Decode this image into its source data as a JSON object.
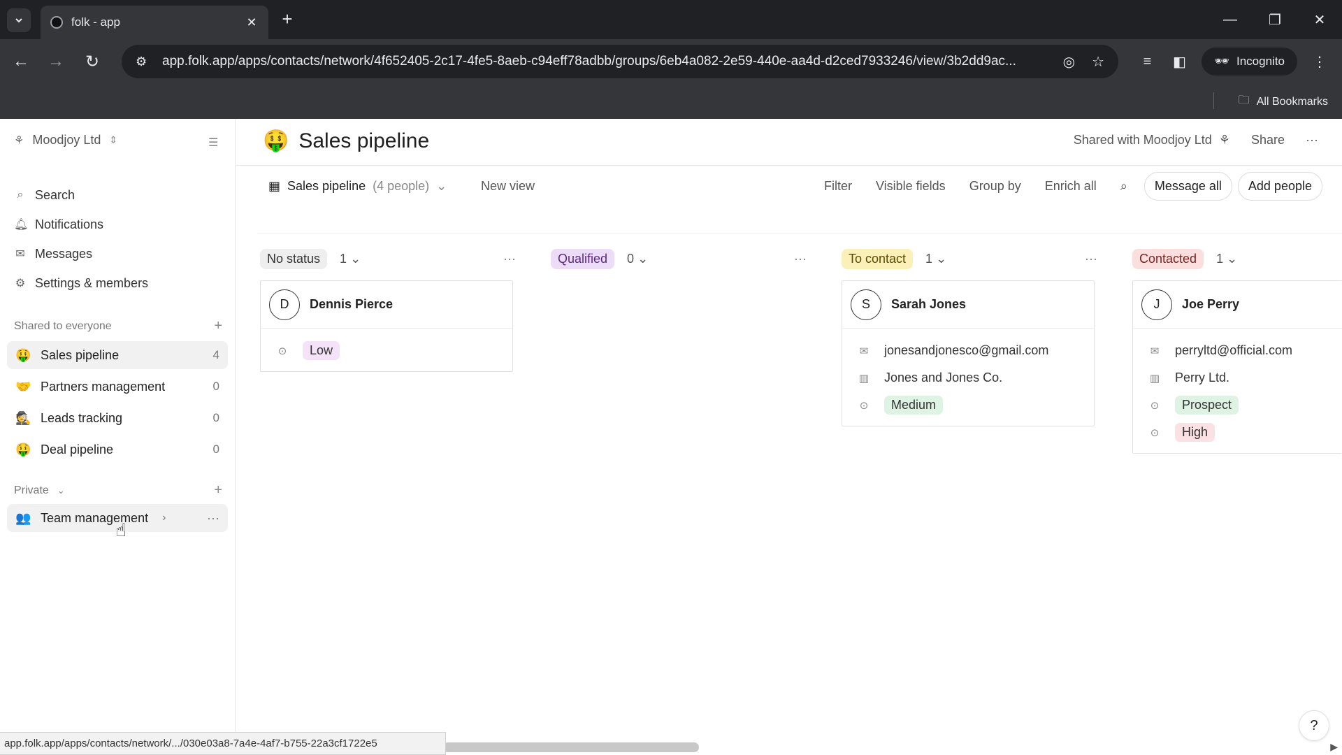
{
  "browser": {
    "tab_title": "folk - app",
    "url": "app.folk.app/apps/contacts/network/4f652405-2c17-4fe5-8aeb-c94eff78adbb/groups/6eb4a082-2e59-440e-aa4d-d2ced7933246/view/3b2dd9ac...",
    "incognito_label": "Incognito",
    "bookmarks_label": "All Bookmarks",
    "status_url": "app.folk.app/apps/contacts/network/.../030e03a8-7a4e-4af7-b755-22a3cf1722e5"
  },
  "sidebar": {
    "workspace": "Moodjoy Ltd",
    "nav": [
      {
        "label": "Search",
        "icon": "search-icon"
      },
      {
        "label": "Notifications",
        "icon": "bell-icon"
      },
      {
        "label": "Messages",
        "icon": "mail-icon"
      },
      {
        "label": "Settings & members",
        "icon": "gear-icon"
      }
    ],
    "shared_header": "Shared to everyone",
    "shared_groups": [
      {
        "emoji": "🤑",
        "label": "Sales pipeline",
        "count": "4"
      },
      {
        "emoji": "🤝",
        "label": "Partners management",
        "count": "0"
      },
      {
        "emoji": "🕵",
        "label": "Leads tracking",
        "count": "0"
      },
      {
        "emoji": "🤑",
        "label": "Deal pipeline",
        "count": "0"
      }
    ],
    "private_header": "Private",
    "private_groups": [
      {
        "emoji": "👥",
        "label": "Team management"
      }
    ]
  },
  "header": {
    "emoji": "🤑",
    "title": "Sales pipeline",
    "shared_with": "Shared with Moodjoy Ltd",
    "share": "Share"
  },
  "viewbar": {
    "view_name": "Sales pipeline",
    "view_count": "(4 people)",
    "new_view": "New view",
    "filter": "Filter",
    "visible_fields": "Visible fields",
    "group_by": "Group by",
    "enrich_all": "Enrich all",
    "message_all": "Message all",
    "add_people": "Add people"
  },
  "columns": [
    {
      "status": "No status",
      "count": "1",
      "bg": "#eeeeee",
      "fg": "#333333"
    },
    {
      "status": "Qualified",
      "count": "0",
      "bg": "#ecdcf7",
      "fg": "#5b2a80"
    },
    {
      "status": "To contact",
      "count": "1",
      "bg": "#fbf1b8",
      "fg": "#5c4a00"
    },
    {
      "status": "Contacted",
      "count": "1",
      "bg": "#fbdede",
      "fg": "#7a2323"
    }
  ],
  "cards": {
    "dennis": {
      "initial": "D",
      "name": "Dennis Pierce",
      "priority": "Low"
    },
    "sarah": {
      "initial": "S",
      "name": "Sarah Jones",
      "email": "jonesandjonesco@gmail.com",
      "company": "Jones and Jones Co.",
      "priority": "Medium"
    },
    "joe": {
      "initial": "J",
      "name": "Joe Perry",
      "email": "perryltd@official.com",
      "company": "Perry Ltd.",
      "stage": "Prospect",
      "priority": "High"
    }
  },
  "tag_colors": {
    "low": "#f3e2f8",
    "medium": "#dff3e4",
    "prospect": "#dff3e4",
    "high": "#fbe0e4"
  },
  "help": "?"
}
